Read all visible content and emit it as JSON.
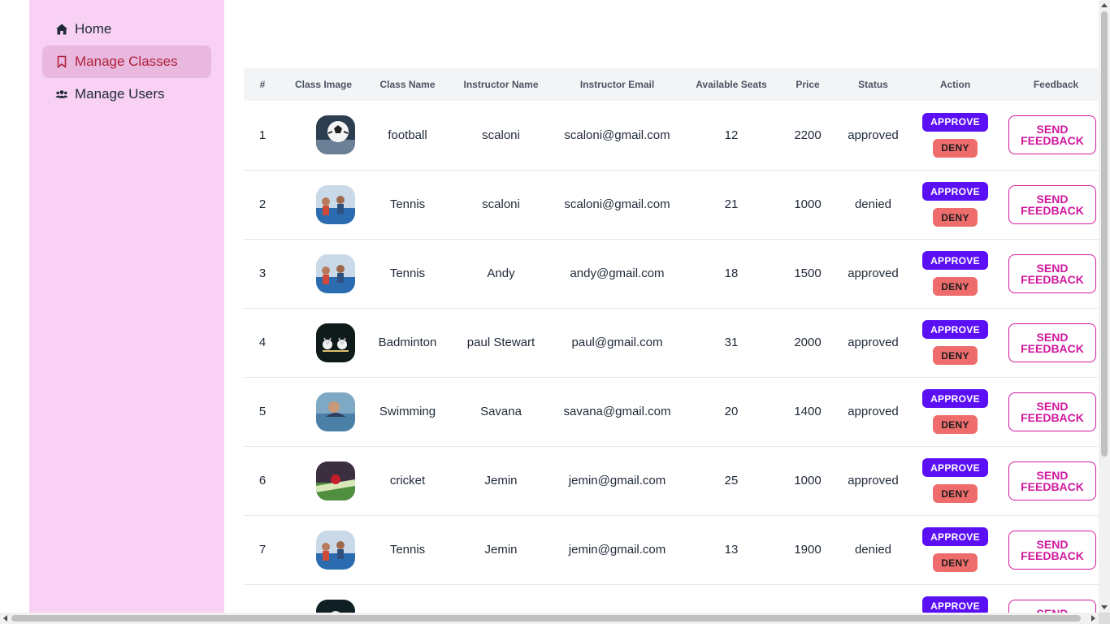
{
  "sidebar": {
    "items": [
      {
        "label": "Home",
        "icon": "home-icon",
        "active": false
      },
      {
        "label": "Manage Classes",
        "icon": "bookmark-icon",
        "active": true
      },
      {
        "label": "Manage Users",
        "icon": "users-icon",
        "active": false
      }
    ]
  },
  "table": {
    "headers": [
      "#",
      "Class Image",
      "Class Name",
      "Instructor Name",
      "Instructor Email",
      "Available Seats",
      "Price",
      "Status",
      "Action",
      "Feedback"
    ],
    "approve_label": "APPROVE",
    "deny_label": "DENY",
    "feedback_label": "SEND FEEDBACK",
    "rows": [
      {
        "index": "1",
        "image": "football-image",
        "class_name": "football",
        "instructor": "scaloni",
        "email": "scaloni@gmail.com",
        "seats": "12",
        "price": "2200",
        "status": "approved"
      },
      {
        "index": "2",
        "image": "tennis-image",
        "class_name": "Tennis",
        "instructor": "scaloni",
        "email": "scaloni@gmail.com",
        "seats": "21",
        "price": "1000",
        "status": "denied"
      },
      {
        "index": "3",
        "image": "tennis-image",
        "class_name": "Tennis",
        "instructor": "Andy",
        "email": "andy@gmail.com",
        "seats": "18",
        "price": "1500",
        "status": "approved"
      },
      {
        "index": "4",
        "image": "badminton-image",
        "class_name": "Badminton",
        "instructor": "paul Stewart",
        "email": "paul@gmail.com",
        "seats": "31",
        "price": "2000",
        "status": "approved"
      },
      {
        "index": "5",
        "image": "swimming-image",
        "class_name": "Swimming",
        "instructor": "Savana",
        "email": "savana@gmail.com",
        "seats": "20",
        "price": "1400",
        "status": "approved"
      },
      {
        "index": "6",
        "image": "cricket-image",
        "class_name": "cricket",
        "instructor": "Jemin",
        "email": "jemin@gmail.com",
        "seats": "25",
        "price": "1000",
        "status": "approved"
      },
      {
        "index": "7",
        "image": "tennis-image",
        "class_name": "Tennis",
        "instructor": "Jemin",
        "email": "jemin@gmail.com",
        "seats": "13",
        "price": "1900",
        "status": "denied"
      },
      {
        "index": "",
        "image": "class-image",
        "class_name": "",
        "instructor": "",
        "email": "",
        "seats": "",
        "price": "",
        "status": ""
      }
    ]
  },
  "colors": {
    "sidebar_bg": "#f9d1f4",
    "active_item_bg": "#e9b8df",
    "active_item_text": "#b0213a",
    "approve": "#5b0ff5",
    "deny": "#ef6c6c",
    "feedback": "#d0179e"
  }
}
